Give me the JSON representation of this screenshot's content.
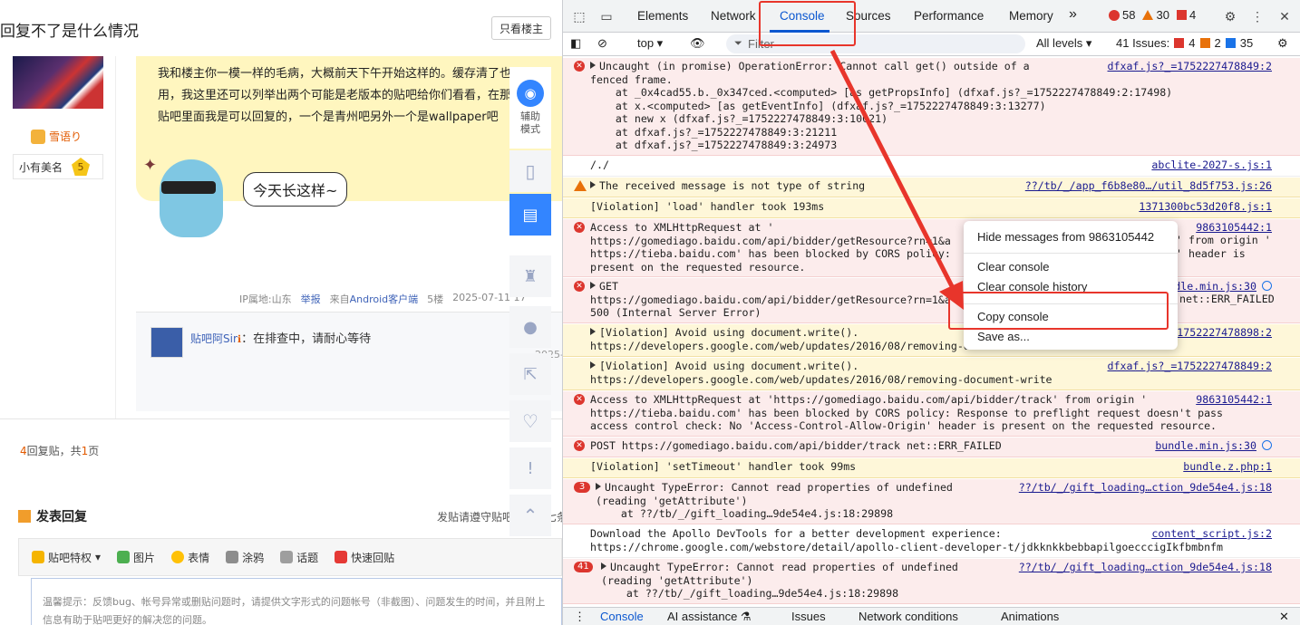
{
  "forum": {
    "thread_title": "回复不了是什么情况",
    "only_op_label": "只看楼主",
    "author": {
      "name": "雪语り",
      "level_title": "小有美名",
      "level_num": "5"
    },
    "post_text": "我和楼主你一模一样的毛病，大概前天下午开始这样的。缓存清了也没用，我这里还可以列举出两个可能是老版本的贴吧给你们看看，在那两个贴吧里面我是可以回复的，一个是青州吧另外一个是wallpaper吧",
    "sticker_caption": "今天长这样~",
    "meta": {
      "ip": "IP属地:山东",
      "report": "举报",
      "from": "来自",
      "client": "Android客户端",
      "floor": "5楼",
      "time": "2025-07-11 17"
    },
    "reply": {
      "user": "贴吧阿Sir",
      "sep": "：",
      "text": "在排查中，请耐心等待",
      "time": "2025-"
    },
    "pager": {
      "replies": "4",
      "replies_label": "回复贴，共",
      "pages": "1",
      "pages_label": "页"
    },
    "post_reply_title": "发表回复",
    "rules_note": "发贴请遵守贴吧协议及七条底线",
    "toolbar": [
      "贴吧特权",
      "图片",
      "表情",
      "涂鸦",
      "话题",
      "快速回贴"
    ],
    "editor_placeholder": "温馨提示：反馈bug、帐号异常或删贴问题时，请提供文字形式的问题帐号（非截图）、问题发生的时间，并且附上信息有助于贴吧更好的解决您的问题。",
    "side_tools": {
      "assist_label": "辅助\n模式"
    }
  },
  "devtools": {
    "tabs": [
      "Elements",
      "Network",
      "Console",
      "Sources",
      "Performance",
      "Memory"
    ],
    "more_tabs": "»",
    "counts": {
      "errors": "58",
      "warnings": "30",
      "issues": "4"
    },
    "toolbar": {
      "context": "top ▾",
      "filter_placeholder": "Filter",
      "levels": "All levels ▾",
      "issues_label": "41 Issues:",
      "issues_err": "4",
      "issues_warn": "2",
      "issues_info": "35"
    },
    "messages": [
      {
        "text": "Uncaught (in promise) OperationError: Cannot call get() outside of a\nfenced frame.\n    at _0x4cad55.b._0x347ced.<computed> [as getPropsInfo] (dfxaf.js?_=1752227478849:2:17498)\n    at x.<computed> [as getEventInfo] (dfxaf.js?_=1752227478849:3:13277)\n    at new x (dfxaf.js?_=1752227478849:3:10021)\n    at dfxaf.js?_=1752227478849:3:21211\n    at dfxaf.js?_=1752227478849:3:24973",
        "src": "dfxaf.js?_=1752227478849:2"
      },
      {
        "text": "/./",
        "src": "abclite-2027-s.js:1"
      },
      {
        "text": "The received message is not type of string",
        "src": "??/tb/_/app_f6b8e80…/util_8d5f753.js:26"
      },
      {
        "text": "[Violation] 'load' handler took 193ms",
        "src": "1371300bc53d20f8.js:1"
      },
      {
        "text": "Access to XMLHttpRequest at '\nhttps://gomediago.baidu.com/api/bidder/getResource?rn=1&a\nhttps://tieba.baidu.com' has been blocked by CORS policy:\npresent on the requested resource.",
        "src": "9863105442:1",
        "right_tail": "' from origin '\n' header is"
      },
      {
        "text": "GET\nhttps://gomediago.baidu.com/api/bidder/getResource?rn=1&a\n500 (Internal Server Error)",
        "src": "bundle.min.js:30",
        "right_tail": "net::ERR_FAILED"
      },
      {
        "text": "[Violation] Avoid using document.write().\nhttps://developers.google.com/web/updates/2016/08/removing-document-write",
        "src": "dfxaf.js?_=1752227478898:2"
      },
      {
        "text": "[Violation] Avoid using document.write().\nhttps://developers.google.com/web/updates/2016/08/removing-document-write",
        "src": "dfxaf.js?_=1752227478849:2"
      },
      {
        "text": "Access to XMLHttpRequest at 'https://gomediago.baidu.com/api/bidder/track' from origin '\nhttps://tieba.baidu.com' has been blocked by CORS policy: Response to preflight request doesn't pass\naccess control check: No 'Access-Control-Allow-Origin' header is present on the requested resource.",
        "src": "9863105442:1"
      },
      {
        "text": "POST https://gomediago.baidu.com/api/bidder/track net::ERR_FAILED",
        "src": "bundle.min.js:30"
      },
      {
        "text": "[Violation] 'setTimeout' handler took 99ms",
        "src": "bundle.z.php:1"
      },
      {
        "count": "3",
        "text": "Uncaught TypeError: Cannot read properties of undefined\n(reading 'getAttribute')\n    at ??/tb/_/gift_loading…9de54e4.js:18:29898",
        "src": "??/tb/_/gift_loading…ction_9de54e4.js:18"
      },
      {
        "text": "Download the Apollo DevTools for a better development experience:\nhttps://chrome.google.com/webstore/detail/apollo-client-developer-t/jdkknkkbebbapilgoecccigIkfbmbnfm",
        "src": "content_script.js:2"
      },
      {
        "count": "41",
        "text": "Uncaught TypeError: Cannot read properties of undefined\n(reading 'getAttribute')\n    at ??/tb/_/gift_loading…9de54e4.js:18:29898",
        "src": "??/tb/_/gift_loading…ction_9de54e4.js:18"
      }
    ],
    "context_menu": [
      "Hide messages from 9863105442",
      "Clear console",
      "Clear console history",
      "Copy console",
      "Save as..."
    ],
    "drawer_tabs": [
      "Console",
      "AI assistance ⚗",
      "Issues",
      "Network conditions",
      "Animations"
    ],
    "colors": {
      "accent": "#0b57d0",
      "error": "#dc362e",
      "warning": "#e8710a",
      "highlight": "#e8352b"
    }
  }
}
